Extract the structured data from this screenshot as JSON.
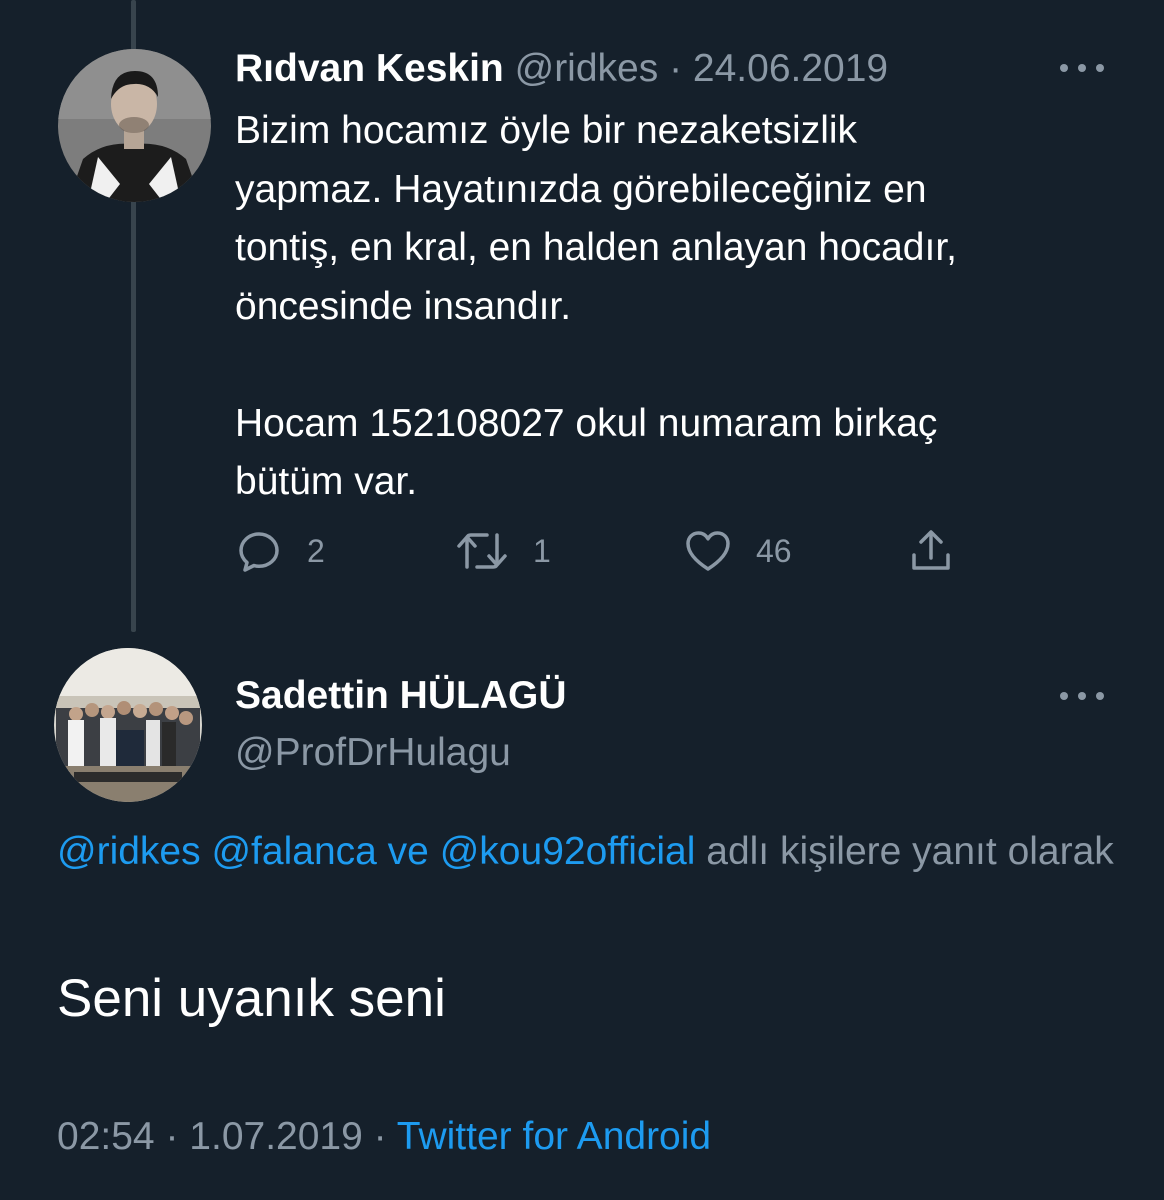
{
  "theme": {
    "background": "#15202b",
    "text_primary": "#ffffff",
    "text_secondary": "#8b98a5",
    "accent": "#1d9bf0",
    "thread_line": "#38444d"
  },
  "parent_tweet": {
    "display_name": "Rıdvan Keskin",
    "handle": "@ridkes",
    "separator": "·",
    "date": "24.06.2019",
    "avatar_icon": "user-photo-avatar",
    "more_icon": "more-horizontal-icon",
    "text": "Bizim hocamız öyle bir nezaketsizlik\nyapmaz. Hayatınızda görebileceğiniz en\ntontiş, en kral, en halden anlayan hocadır,\nöncesinde insandır.\n\nHocam 152108027 okul numaram birkaç\nbütüm var.",
    "actions": {
      "reply_icon": "reply-bubble-icon",
      "reply_count": "2",
      "retweet_icon": "retweet-icon",
      "retweet_count": "1",
      "like_icon": "heart-icon",
      "like_count": "46",
      "share_icon": "share-icon"
    }
  },
  "reply_tweet": {
    "display_name": "Sadettin HÜLAGÜ",
    "handle": "@ProfDrHulagu",
    "avatar_icon": "group-photo-avatar",
    "more_icon": "more-horizontal-icon",
    "replying_to": {
      "mention_1": "@ridkes",
      "mention_2": "@falanca",
      "conjunction": "ve",
      "mention_3": "@kou92official",
      "suffix": "adlı kişilere yanıt olarak"
    },
    "text": "Seni uyanık seni",
    "time": "02:54",
    "separator": "·",
    "date": "1.07.2019",
    "source": "Twitter for Android"
  }
}
